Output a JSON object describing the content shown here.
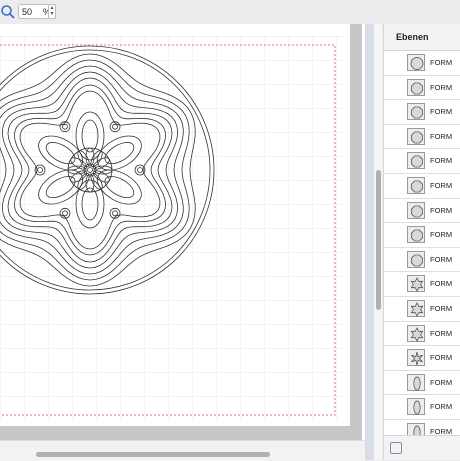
{
  "toolbar": {
    "zoom_icon": "magnifier-icon",
    "zoom_value": "50",
    "zoom_unit": "%"
  },
  "canvas": {
    "artwork": "mandala-flower-layered-design"
  },
  "layers_panel": {
    "title": "Ebenen",
    "items": [
      {
        "label": "FORM",
        "shape": "circle"
      },
      {
        "label": "FORM",
        "shape": "octagon"
      },
      {
        "label": "FORM",
        "shape": "octagon"
      },
      {
        "label": "FORM",
        "shape": "octagon"
      },
      {
        "label": "FORM",
        "shape": "octagon"
      },
      {
        "label": "FORM",
        "shape": "octagon"
      },
      {
        "label": "FORM",
        "shape": "octagon"
      },
      {
        "label": "FORM",
        "shape": "octagon"
      },
      {
        "label": "FORM",
        "shape": "octagon"
      },
      {
        "label": "FORM",
        "shape": "star"
      },
      {
        "label": "FORM",
        "shape": "star"
      },
      {
        "label": "FORM",
        "shape": "star"
      },
      {
        "label": "FORM",
        "shape": "star-sharp"
      },
      {
        "label": "FORM",
        "shape": "ellipse"
      },
      {
        "label": "FORM",
        "shape": "ellipse"
      },
      {
        "label": "FORM",
        "shape": "ellipse"
      }
    ],
    "footer_icon": "layer-options-icon"
  },
  "colors": {
    "accent": "#3a6fd8",
    "guide": "#d94a4a",
    "line": "#333333"
  }
}
